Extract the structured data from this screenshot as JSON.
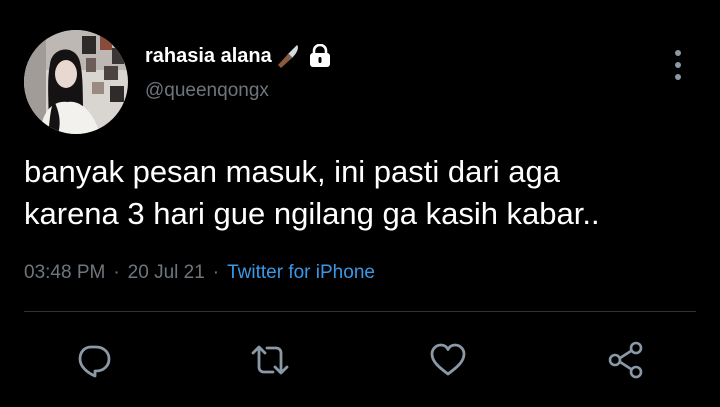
{
  "colors": {
    "background": "#000000",
    "primary_text": "#ffffff",
    "secondary_text": "#6e767d",
    "link": "#3a98e6",
    "icon": "#8b98a5",
    "divider": "#2f3336"
  },
  "author": {
    "avatar": "profile-photo",
    "display_name": "rahasia alana",
    "name_emoji": "knife-emoji",
    "protected_icon": "lock-icon",
    "handle": "@queenqongx"
  },
  "header": {
    "more_icon": "vertical-ellipsis-icon"
  },
  "tweet": {
    "lines": [
      "banyak pesan masuk, ini pasti dari aga",
      "karena 3 hari gue ngilang ga kasih kabar.."
    ],
    "time": "03:48 PM",
    "separator": "·",
    "date": "20 Jul 21",
    "source": "Twitter for iPhone"
  },
  "actions": [
    {
      "name": "reply",
      "icon": "reply-bubble-icon"
    },
    {
      "name": "retweet",
      "icon": "retweet-icon"
    },
    {
      "name": "like",
      "icon": "heart-icon"
    },
    {
      "name": "share",
      "icon": "share-icon"
    }
  ]
}
